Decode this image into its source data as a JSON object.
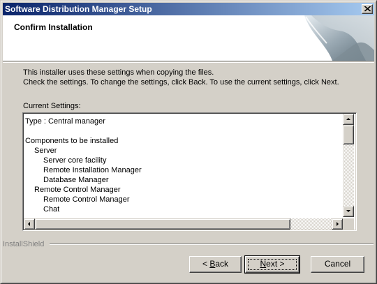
{
  "window": {
    "title": "Software Distribution Manager Setup"
  },
  "header": {
    "title": "Confirm Installation"
  },
  "intro": {
    "line1": "This installer uses these settings when copying the files.",
    "line2": "Check the settings. To change the settings, click Back. To use the current settings, click Next."
  },
  "settings": {
    "label": "Current Settings:",
    "lines": [
      {
        "text": "Type : Central manager",
        "indent": 0
      },
      {
        "text": "",
        "indent": 0
      },
      {
        "text": "Components to be installed",
        "indent": 0
      },
      {
        "text": "Server",
        "indent": 1
      },
      {
        "text": "Server core facility",
        "indent": 2
      },
      {
        "text": "Remote Installation Manager",
        "indent": 2
      },
      {
        "text": "Database Manager",
        "indent": 2
      },
      {
        "text": "Remote Control Manager",
        "indent": 1
      },
      {
        "text": "Remote Control Manager",
        "indent": 2
      },
      {
        "text": "Chat",
        "indent": 2
      }
    ]
  },
  "footer": {
    "brand": "InstallShield",
    "back_prefix": "< ",
    "back_mnemonic": "B",
    "back_rest": "ack",
    "next_mnemonic": "N",
    "next_rest": "ext >",
    "cancel_label": "Cancel"
  }
}
